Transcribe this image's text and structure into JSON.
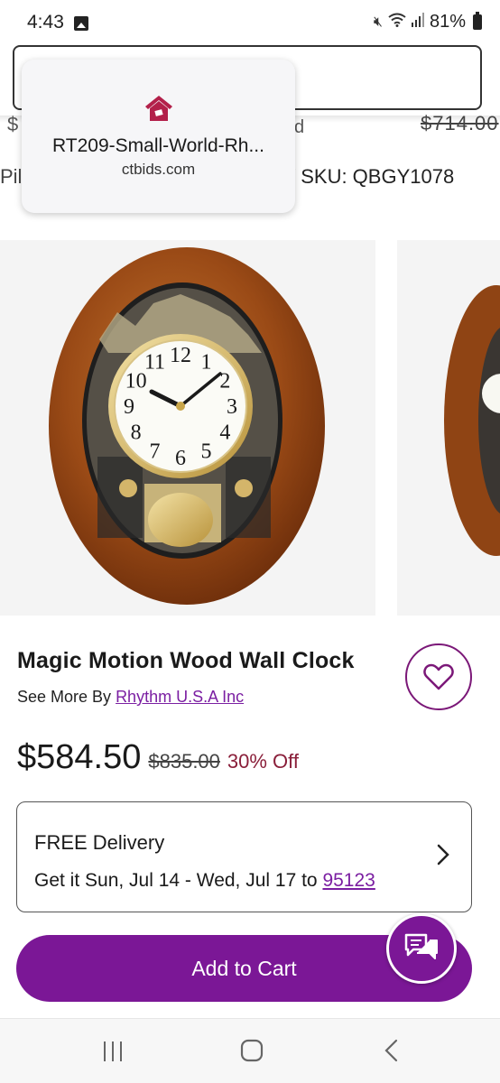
{
  "status_bar": {
    "time": "4:43",
    "battery": "81%",
    "icons": [
      "image-icon",
      "mute-icon",
      "wifi-icon",
      "signal-icon",
      "battery-icon"
    ]
  },
  "background": {
    "cut_price_left": "$",
    "cut_d": "d",
    "cut_price_right": "$714.00",
    "breadcrumb_left": "Pil",
    "breadcrumb": "/ SKU: QBGY1078"
  },
  "link_popup": {
    "title": "RT209-Small-World-Rh...",
    "domain": "ctbids.com",
    "logo_color": "#b3204a"
  },
  "product": {
    "title": "Magic Motion Wood Wall Clock",
    "see_more_prefix": "See More By",
    "brand": "Rhythm U.S.A Inc",
    "sale_price": "$584.50",
    "original_price": "$835.00",
    "discount": "30% Off"
  },
  "clock_numerals": [
    "12",
    "1",
    "2",
    "3",
    "4",
    "5",
    "6",
    "7",
    "8",
    "9",
    "10",
    "11"
  ],
  "delivery": {
    "title": "FREE Delivery",
    "date_prefix": "Get it Sun, Jul 14 - Wed, Jul 17 to",
    "zip": "95123"
  },
  "actions": {
    "add_to_cart": "Add to Cart"
  },
  "colors": {
    "accent": "#7b1796",
    "discount": "#8a1f3a",
    "link": "#7b1fa2"
  }
}
